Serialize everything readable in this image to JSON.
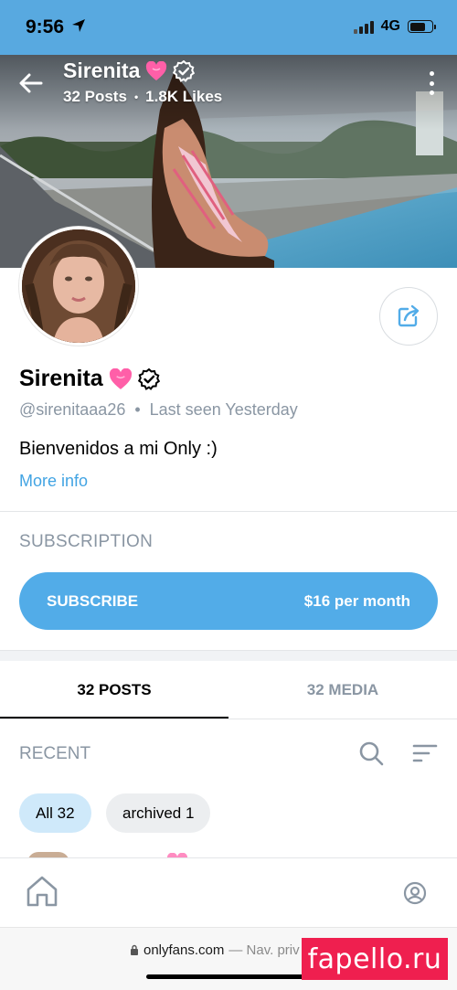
{
  "status_bar": {
    "time": "9:56",
    "network": "4G"
  },
  "cover": {
    "title": "Sirenita",
    "posts": "32 Posts",
    "likes": "1.8K Likes"
  },
  "profile": {
    "name": "Sirenita",
    "handle": "@sirenitaaa26",
    "last_seen": "Last seen Yesterday",
    "bio": "Bienvenidos a mi Only :)",
    "more_info": "More info"
  },
  "subscription": {
    "heading": "SUBSCRIPTION",
    "button_label": "SUBSCRIBE",
    "price": "$16 per month"
  },
  "tabs": [
    {
      "label": "32 POSTS",
      "active": true
    },
    {
      "label": "32 MEDIA",
      "active": false
    }
  ],
  "recent": {
    "label": "RECENT"
  },
  "filters": [
    {
      "label": "All 32",
      "selected": true
    },
    {
      "label": "archived 1",
      "selected": false
    }
  ],
  "url_bar": {
    "domain": "onlyfans.com",
    "suffix": "— Nav. priv"
  },
  "watermark": "fapello.ru",
  "colors": {
    "accent": "#52ace8",
    "status_bar": "#58a9e0",
    "muted_text": "#8a96a3",
    "selected_chip": "#cfe9fa",
    "heart": "#ff5fa8",
    "watermark_bg": "#ef1f4f"
  },
  "icons": [
    "location-arrow-icon",
    "back-arrow-icon",
    "heart-icon",
    "verified-icon",
    "more-vertical-icon",
    "share-icon",
    "search-icon",
    "sort-icon",
    "home-icon",
    "account-icon",
    "lock-icon"
  ]
}
